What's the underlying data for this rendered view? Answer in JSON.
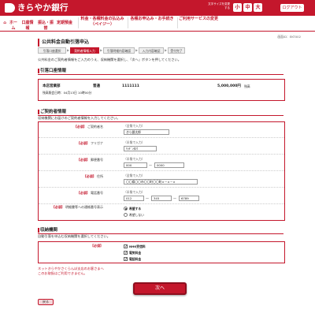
{
  "header": {
    "logo_text": "きらやか銀行",
    "font_size_label": "文字サイズを変更する",
    "font_sizes": [
      "小",
      "中",
      "大"
    ],
    "logout": "ログアウト"
  },
  "nav": {
    "items": [
      {
        "icon": "home-icon",
        "label": "ホーム"
      },
      {
        "label": "口座情報"
      },
      {
        "label": "振込・振替"
      },
      {
        "label": "定期預金"
      },
      {
        "label": "料金・各種料金の払込み（ペイジー）"
      },
      {
        "label": "各種お申込み・お手続き"
      },
      {
        "label": "ご利用サービスの変更"
      }
    ]
  },
  "customer_no": "画面ID：EKT002",
  "page_title": "公共料金自動引落申込",
  "steps": [
    "引落口座選択",
    "契約者情報入力",
    "引落明細内容確認",
    "入力内容確認",
    "受付完了"
  ],
  "intro": "公共料金のご契約者情報をご入力のうえ、収納機関を選択し、「次へ」ボタンを押してください。",
  "debit_account": {
    "heading": "引落口座情報",
    "branch": "本店営業部",
    "type": "普通",
    "number": "1111111",
    "balance": "5,000,000円",
    "balance_suffix": "残高",
    "balance_date": "残高照会日時：04月13日 10時00分"
  },
  "contract": {
    "heading": "ご契約者情報",
    "note": "収納機関にお届けのご契約者情報を入力してください。",
    "required_label": "【必須】",
    "name": {
      "label": "ご契約者名",
      "hint": "（全角で入力）",
      "value": "きら銀太郎"
    },
    "kana": {
      "label": "フリガナ",
      "hint": "（半角で入力）",
      "value": "ｷﾗｷﾞﾝﾀﾛｳ"
    },
    "postal": {
      "label": "郵便番号",
      "hint": "（半角で入力）",
      "value1": "000",
      "value2": "0000"
    },
    "address": {
      "label": "住所",
      "hint": "（全角で入力）",
      "value": "〇〇県〇〇市〇〇町〇〇町×－×－×"
    },
    "phone": {
      "label": "電話番号",
      "hint": "（半角で入力）",
      "value1": "012",
      "value2": "345",
      "value3": "6789"
    },
    "notify": {
      "label": "明細書等への通帳番号表示",
      "options": [
        "希望する",
        "希望しない"
      ],
      "selected": "希望する"
    }
  },
  "receivers": {
    "heading": "収納機関",
    "note": "自動引落を申込む収納機関を選択してください。",
    "required_label": "【必須】",
    "items": [
      {
        "label": "NHK受信料",
        "checked": true
      },
      {
        "label": "電気料金",
        "checked": true
      },
      {
        "label": "電話料金",
        "checked": true
      }
    ]
  },
  "notice_line1": "ネットきらやかさくらんぼ支店のお客さまへ",
  "notice_line2": "このお取扱はご利用できません。",
  "next_button": "次へ",
  "back_button": "戻る",
  "colors": {
    "brand": "#c4172c"
  }
}
